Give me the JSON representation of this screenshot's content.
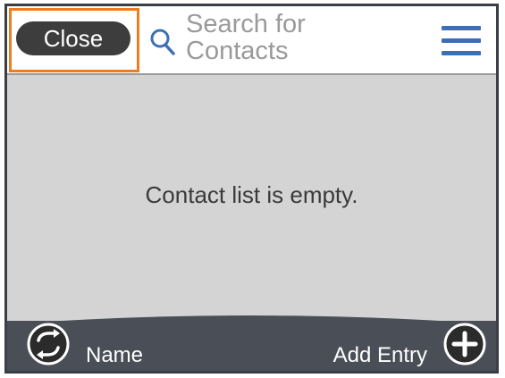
{
  "header": {
    "close_label": "Close",
    "search_text": "Search for Contacts",
    "search_icon": "search-icon",
    "menu_icon": "hamburger-menu-icon"
  },
  "content": {
    "empty_message": "Contact list is empty."
  },
  "bottom_bar": {
    "sort_icon": "sort-toggle-icon",
    "sort_label": "Name",
    "add_icon": "plus-icon",
    "add_label": "Add Entry"
  },
  "colors": {
    "focus_outline": "#ee7d1f",
    "menu_accent": "#3e6fb5",
    "close_button": "#3d3d3d",
    "content_background": "#d4d4d4",
    "bottom_bar": "#4a4f57"
  }
}
